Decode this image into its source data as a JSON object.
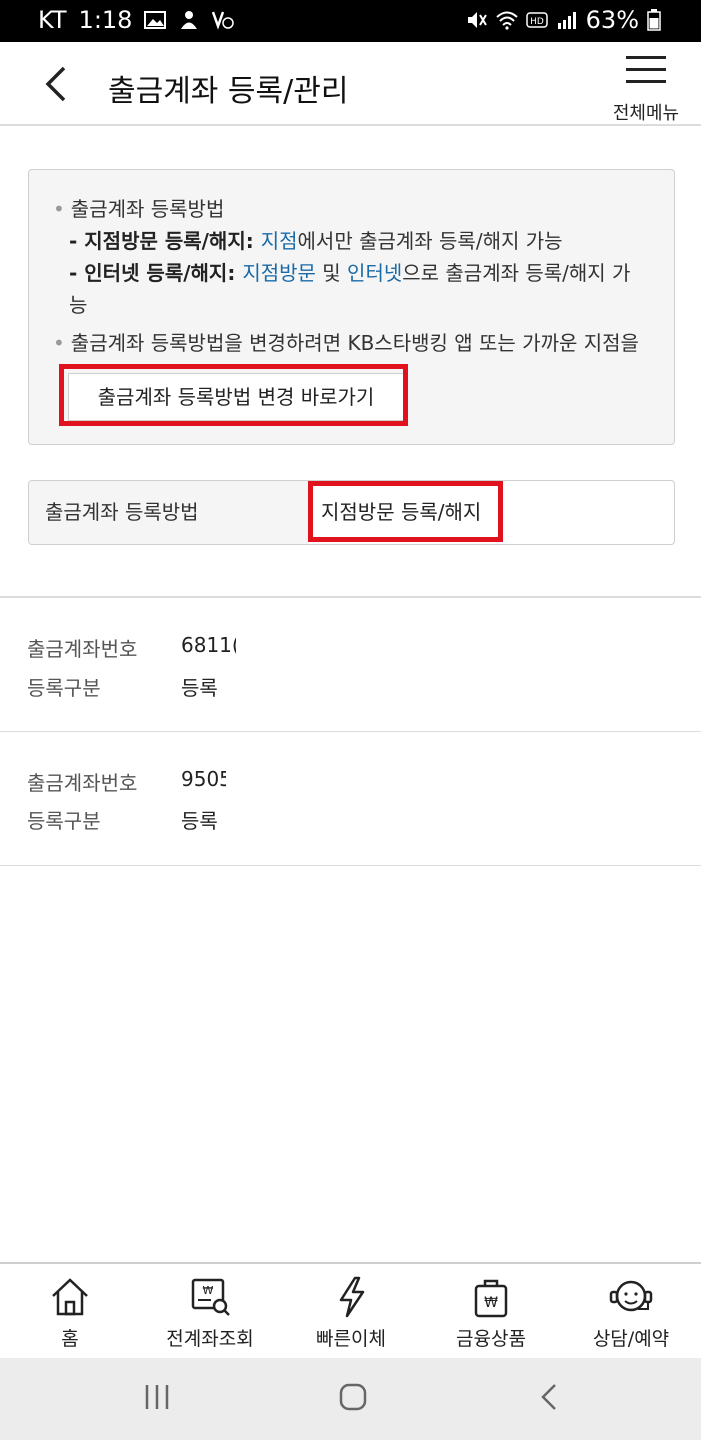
{
  "status_bar": {
    "carrier": "KT",
    "time": "1:18",
    "battery": "63%"
  },
  "header": {
    "title": "출금계좌 등록/관리",
    "menu_label": "전체메뉴"
  },
  "info": {
    "item1_title": "출금계좌 등록방법",
    "line1_bold": "- 지점방문 등록/해지",
    "line1_colon": ": ",
    "line1_link": "지점",
    "line1_rest": "에서만 출금계좌 등록/해지 가능",
    "line2_bold": "- 인터넷 등록/해지",
    "line2_colon": ": ",
    "line2_link1": "지점방문",
    "line2_mid": " 및 ",
    "line2_link2": "인터넷",
    "line2_rest": "으로 출금계좌 등록/해지 가능",
    "item2_text": "출금계좌 등록방법을 변경하려면 KB스타뱅킹 앱 또는 가까운 지점을 이용해주세요.",
    "change_button": "출금계좌 등록방법 변경 바로가기"
  },
  "method": {
    "label": "출금계좌 등록방법",
    "value": "지점방문 등록/해지"
  },
  "accounts": [
    {
      "number_label": "출금계좌번호",
      "number": "6811(",
      "type_label": "등록구분",
      "type": "등록"
    },
    {
      "number_label": "출금계좌번호",
      "number": "9505",
      "type_label": "등록구분",
      "type": "등록"
    }
  ],
  "bottom_nav": [
    {
      "label": "홈",
      "icon": "home-icon"
    },
    {
      "label": "전계좌조회",
      "icon": "account-search-icon"
    },
    {
      "label": "빠른이체",
      "icon": "lightning-icon"
    },
    {
      "label": "금융상품",
      "icon": "shopping-bag-icon"
    },
    {
      "label": "상담/예약",
      "icon": "headset-icon"
    }
  ],
  "colors": {
    "highlight": "#e0121e",
    "link": "#1a6aa8"
  }
}
